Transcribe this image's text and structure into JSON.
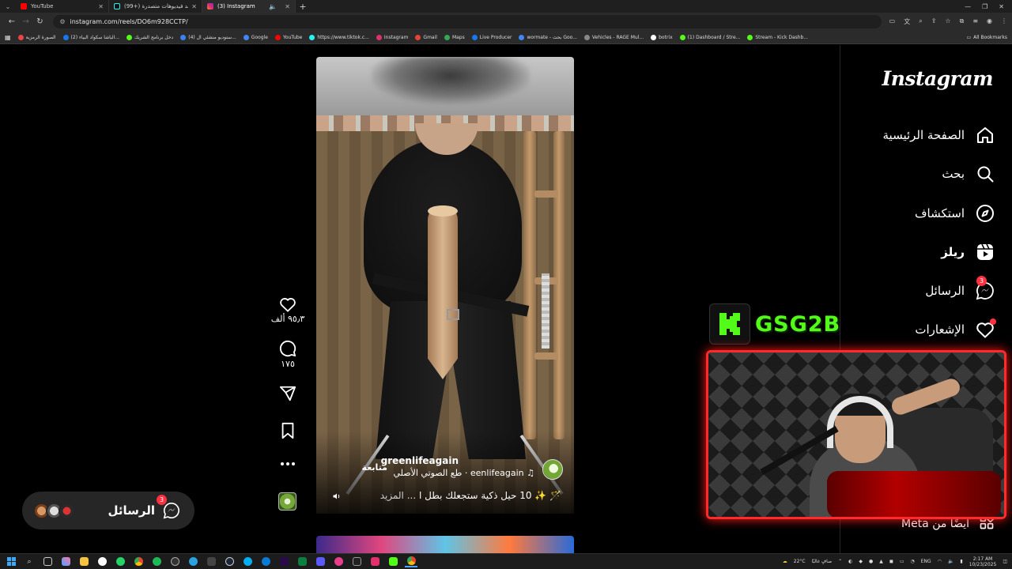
{
  "browser": {
    "tabs": [
      {
        "label": "YouTube",
        "color": "#ff0000",
        "active": false
      },
      {
        "label": "(99+) شاهد فيديوهات متصدرة |",
        "color": "#111111",
        "active": false
      },
      {
        "label": "(3) Instagram",
        "color": "#e1306c",
        "active": true
      }
    ],
    "url": "instagram.com/reels/DO6m928CCTP/",
    "bookmarks": [
      {
        "label": "الصورة الرمزية",
        "color": "#e44"
      },
      {
        "label": "(2) الباشا سكواد البياء...",
        "color": "#1877f2"
      },
      {
        "label": "دخل برنامج الشريك",
        "color": "#53fc18"
      },
      {
        "label": "(4) ستوديو منشئي ال...",
        "color": "#3b82f6"
      },
      {
        "label": "Google",
        "color": "#4285f4"
      },
      {
        "label": "YouTube",
        "color": "#ff0000"
      },
      {
        "label": "https://www.tiktok.c...",
        "color": "#25f4ee"
      },
      {
        "label": "Instagram",
        "color": "#e1306c"
      },
      {
        "label": "Gmail",
        "color": "#ea4335"
      },
      {
        "label": "Maps",
        "color": "#34a853"
      },
      {
        "label": "Live Producer",
        "color": "#1877f2"
      },
      {
        "label": "wormate - بحث Goo...",
        "color": "#4285f4"
      },
      {
        "label": "Vehicles - RAGE Mul...",
        "color": "#888888"
      },
      {
        "label": "botrix",
        "color": "#ffffff"
      },
      {
        "label": "(1) Dashboard / Stre...",
        "color": "#53fc18"
      },
      {
        "label": "Stream - Kick Dashb...",
        "color": "#53fc18"
      }
    ],
    "all_bookmarks": "All Bookmarks"
  },
  "reel": {
    "username": "greenlifeagain",
    "follow": "متابعة",
    "audio": "♫ eenlifeagain · طع الصوتي الأصلي",
    "caption": "🪄 ✨ 10 حيل ذكية ستجعلك بطل ا",
    "caption_more": "... المزيد"
  },
  "actions": {
    "likes": "٩٥٫٣ ألف",
    "comments": "١٧٥"
  },
  "messages_pill": {
    "label": "الرسائل",
    "badge": "3"
  },
  "sidebar": {
    "logo": "Instagram",
    "items": [
      {
        "label": "الصفحة الرئيسية",
        "icon": "home-icon"
      },
      {
        "label": "بحث",
        "icon": "search-icon"
      },
      {
        "label": "استكشاف",
        "icon": "compass-icon"
      },
      {
        "label": "ريلز",
        "icon": "reels-icon"
      },
      {
        "label": "الرسائل",
        "icon": "messenger-icon",
        "badge": "3"
      },
      {
        "label": "الإشعارات",
        "icon": "heart-icon",
        "dot": true
      }
    ],
    "meta": "ايضًا من Meta"
  },
  "stream": {
    "channel": "GSG2B",
    "kick_color": "#53fc18"
  },
  "taskbar": {
    "weather": "22°C",
    "weather_text": "صافٍ غالبًا",
    "lang": "ENG",
    "time": "2:17 AM",
    "date": "10/23/2025"
  }
}
